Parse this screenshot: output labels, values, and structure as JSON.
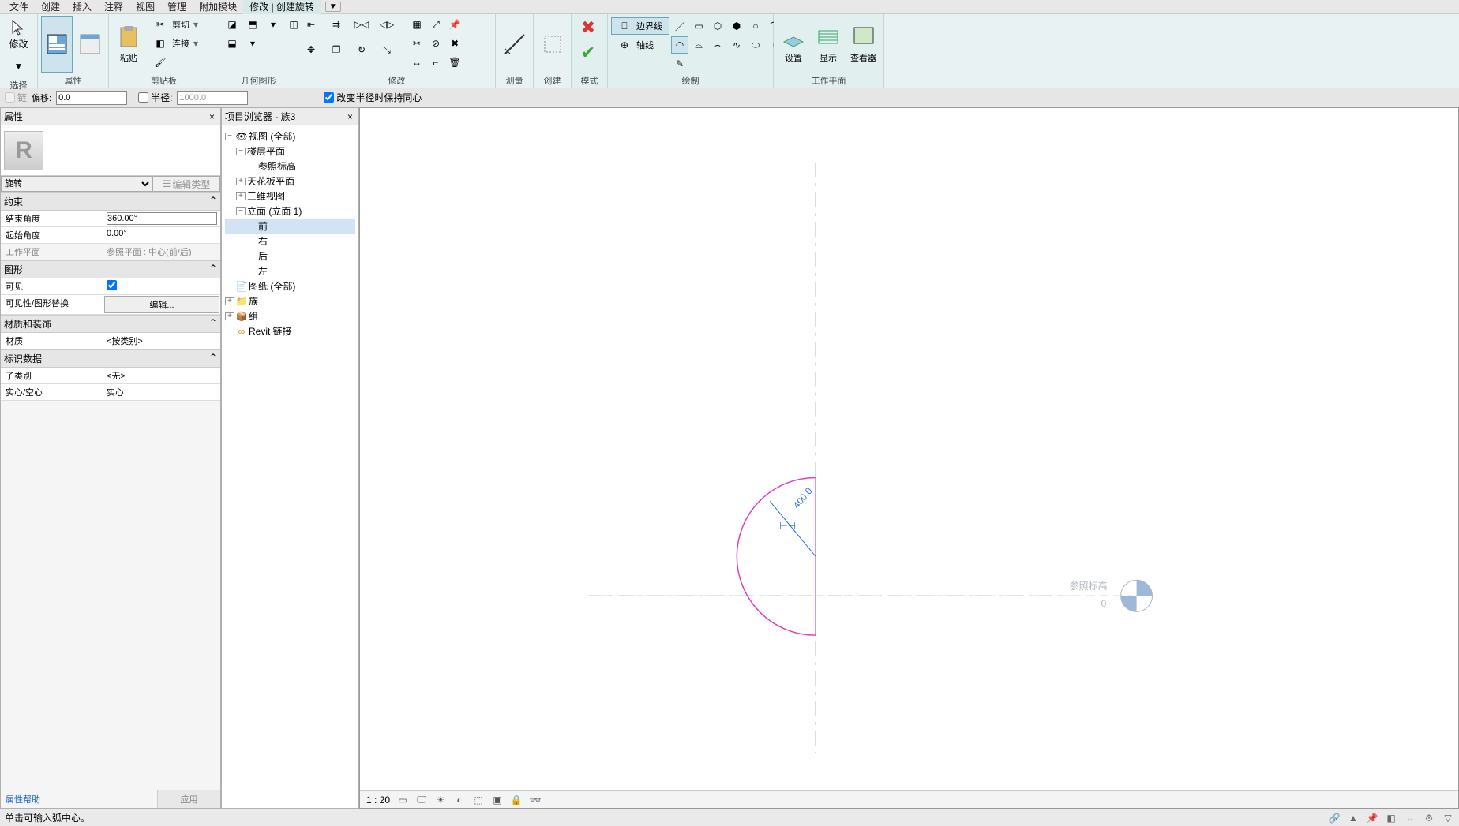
{
  "menu": {
    "items": [
      "文件",
      "创建",
      "插入",
      "注释",
      "视图",
      "管理",
      "附加模块"
    ],
    "active": "修改 | 创建旋转",
    "overflow": "▼"
  },
  "ribbon": {
    "groups": {
      "select": {
        "label": "选择",
        "modify": "修改"
      },
      "properties": {
        "label": "属性"
      },
      "clipboard": {
        "label": "剪贴板",
        "paste": "粘贴",
        "cut": "剪切",
        "join": "连接"
      },
      "geometry": {
        "label": "几何图形"
      },
      "modify": {
        "label": "修改"
      },
      "measure": {
        "label": "测量"
      },
      "create": {
        "label": "创建"
      },
      "mode": {
        "label": "模式"
      },
      "draw": {
        "label": "绘制",
        "boundary": "边界线",
        "axis": "轴线"
      },
      "workplane": {
        "label": "工作平面",
        "set": "设置",
        "show": "显示",
        "viewer": "查看器"
      }
    }
  },
  "optbar": {
    "chain": "链",
    "offset_label": "偏移:",
    "offset_value": "0.0",
    "radius_label": "半径:",
    "radius_value": "1000.0",
    "keep_concentric": "改变半径时保持同心"
  },
  "props_panel": {
    "title": "属性",
    "type": "旋转",
    "edit_type": "编辑类型",
    "sections": {
      "constraints": "约束",
      "graphics": "图形",
      "materials": "材质和装饰",
      "identity": "标识数据"
    },
    "rows": {
      "end_angle_k": "结束角度",
      "end_angle_v": "360.00°",
      "start_angle_k": "起始角度",
      "start_angle_v": "0.00°",
      "workplane_k": "工作平面",
      "workplane_v": "参照平面 : 中心(前/后)",
      "visible_k": "可见",
      "vis_override_k": "可见性/图形替换",
      "vis_override_v": "编辑...",
      "material_k": "材质",
      "material_v": "<按类别>",
      "subcat_k": "子类别",
      "subcat_v": "<无>",
      "solid_k": "实心/空心",
      "solid_v": "实心"
    },
    "help": "属性帮助",
    "apply": "应用"
  },
  "browser": {
    "title": "项目浏览器 - 族3",
    "nodes": {
      "views": "视图 (全部)",
      "floor_plans": "楼层平面",
      "ref_level": "参照标高",
      "ceiling_plans": "天花板平面",
      "three_d": "三维视图",
      "elevations": "立面 (立面 1)",
      "front": "前",
      "right": "右",
      "back": "后",
      "left": "左",
      "sheets": "图纸 (全部)",
      "families": "族",
      "groups": "组",
      "revit_links": "Revit 链接"
    }
  },
  "canvas": {
    "dimension": "400.0",
    "ref_label": "参照标高",
    "ref_value": "0",
    "scale": "1 : 20"
  },
  "status": {
    "hint": "单击可输入弧中心。"
  }
}
